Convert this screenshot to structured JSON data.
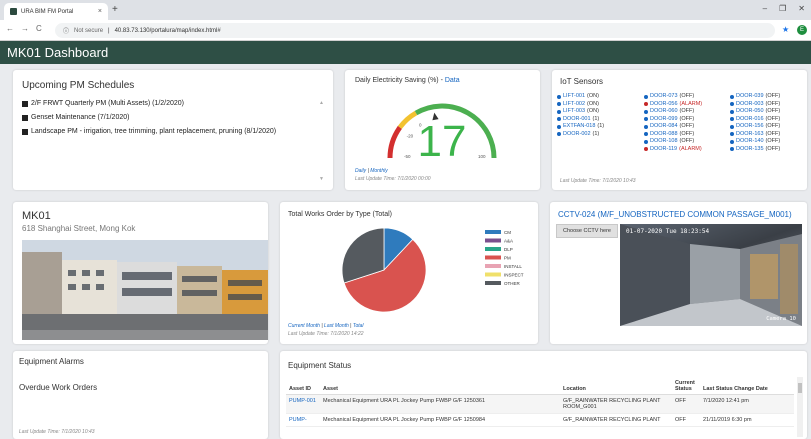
{
  "browser": {
    "tab_title": "URA BIM FM Portal",
    "url": "40.83.73.130/portalura/map/index.html#",
    "security": "Not secure",
    "profile_initial": "E"
  },
  "app": {
    "title": "MK01 Dashboard",
    "header_color": "#2e4f45"
  },
  "pm": {
    "title": "Upcoming PM Schedules",
    "items": [
      "2/F FRWT Quarterly PM (Multi Assets) (1/2/2020)",
      "Genset Maintenance (7/1/2020)",
      "Landscape PM - irrigation, tree trimming, plant replacement, pruning (8/1/2020)"
    ]
  },
  "electricity": {
    "title": "Daily Electricity Saving (%) - ",
    "title_link": "Data",
    "value": "17",
    "gauge_value": 17,
    "gauge_min": -50,
    "gauge_max": 100,
    "ticks": [
      "-50",
      "-20",
      "0",
      "100"
    ],
    "link_daily": "Daily",
    "link_sep": " | ",
    "link_monthly": "Monthly",
    "last_update": "Last Update Time: 7/1/2020 00:00"
  },
  "iot": {
    "title": "IoT Sensors",
    "columns": [
      [
        {
          "id": "LIFT-001",
          "state": " (ON)",
          "status": "normal"
        },
        {
          "id": "LIFT-002",
          "state": " (ON)",
          "status": "normal"
        },
        {
          "id": "LIFT-003",
          "state": " (ON)",
          "status": "normal"
        },
        {
          "id": "DOOR-001",
          "state": " (1)",
          "status": "normal"
        },
        {
          "id": "EXTFAN-018",
          "state": " (1)",
          "status": "normal"
        },
        {
          "id": "DOOR-002",
          "state": " (1)",
          "status": "normal"
        }
      ],
      [
        {
          "id": "DOOR-073",
          "state": " (OFF)",
          "status": "normal"
        },
        {
          "id": "DOOR-056",
          "state": " (ALARM)",
          "status": "alarm"
        },
        {
          "id": "DOOR-060",
          "state": " (OFF)",
          "status": "normal"
        },
        {
          "id": "DOOR-099",
          "state": " (OFF)",
          "status": "normal"
        },
        {
          "id": "DOOR-084",
          "state": " (OFF)",
          "status": "normal"
        },
        {
          "id": "DOOR-088",
          "state": " (OFF)",
          "status": "normal"
        },
        {
          "id": "DOOR-108",
          "state": " (OFF)",
          "status": "normal"
        },
        {
          "id": "DOOR-119",
          "state": " (ALARM)",
          "status": "alarm"
        }
      ],
      [
        {
          "id": "DOOR-039",
          "state": " (OFF)",
          "status": "normal"
        },
        {
          "id": "DOOR-003",
          "state": " (OFF)",
          "status": "normal"
        },
        {
          "id": "DOOR-050",
          "state": " (OFF)",
          "status": "normal"
        },
        {
          "id": "DOOR-016",
          "state": " (OFF)",
          "status": "normal"
        },
        {
          "id": "DOOR-156",
          "state": " (OFF)",
          "status": "normal"
        },
        {
          "id": "DOOR-163",
          "state": " (OFF)",
          "status": "normal"
        },
        {
          "id": "DOOR-140",
          "state": " (OFF)",
          "status": "normal"
        },
        {
          "id": "DOOR-135",
          "state": " (OFF)",
          "status": "normal"
        }
      ]
    ],
    "normal_color": "#1565c0",
    "alarm_color": "#c62828",
    "last_update": "Last Update Time: 7/1/2020 10:43"
  },
  "site": {
    "name": "MK01",
    "address": "618 Shanghai Street, Mong Kok"
  },
  "works": {
    "title": "Total Works Order by Type (Total)",
    "link_current": "Current Month",
    "link_sep": " | ",
    "link_last": "Last Month",
    "link_total": "Total",
    "last_update": "Last Update Time: 7/1/2020 14:22"
  },
  "chart_data": {
    "type": "pie",
    "title": "Total Works Order by Type (Total)",
    "categories": [
      "CM",
      "A&A",
      "DLP",
      "PM",
      "INSTALL",
      "INSPECT",
      "OTHER"
    ],
    "values": [
      12,
      0,
      0,
      58,
      0,
      0,
      30
    ],
    "colors": [
      "#2f7bbd",
      "#7b4f8e",
      "#2aa58a",
      "#d9534f",
      "#e8a3b3",
      "#f0e06b",
      "#555a5f"
    ],
    "legend": "right"
  },
  "cctv": {
    "title": "CCTV-024 (M/F_UNOBSTRUCTED COMMON PASSAGE_M001)",
    "button": "Choose CCTV here",
    "timestamp": "01-07-2020 Tue 18:23:54",
    "camera_label": "Camera 10"
  },
  "alarms": {
    "title": "Equipment Alarms",
    "overdue": "Overdue Work Orders",
    "last_update": "Last Update Time: 7/1/2020 10:43"
  },
  "equipment": {
    "title": "Equipment Status",
    "headers": [
      "Asset ID",
      "Asset",
      "Location",
      "Current Status",
      "Last Status Change Date"
    ],
    "rows": [
      [
        "PUMP-001",
        "Mechanical Equipment URA PL Jockey Pump FWBP G/F 1250361",
        "G/F_RAINWATER RECYCLING PLANT ROOM_G001",
        "OFF",
        "7/1/2020 12:41 pm"
      ],
      [
        "PUMP-",
        "Mechanical Equipment URA PL Jockey Pump FWBP G/F 1250984",
        "G/F_RAINWATER RECYCLING PLANT",
        "OFF",
        "21/11/2019 6:30 pm"
      ]
    ]
  }
}
